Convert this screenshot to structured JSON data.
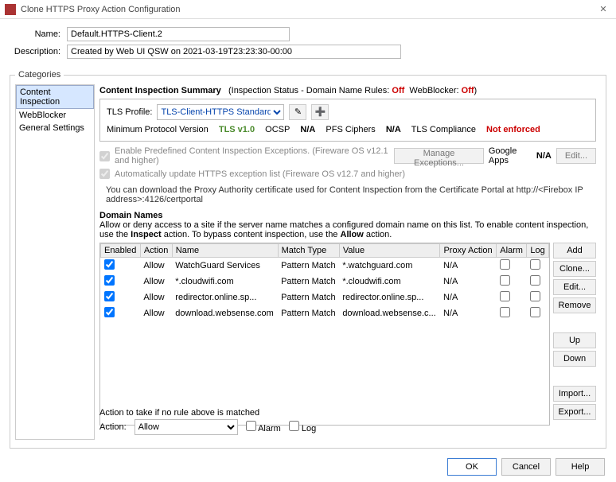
{
  "title": "Clone HTTPS Proxy Action Configuration",
  "name_label": "Name:",
  "name_value": "Default.HTTPS-Client.2",
  "desc_label": "Description:",
  "desc_value": "Created by Web UI QSW on 2021-03-19T23:23:30-00:00",
  "categories_legend": "Categories",
  "sidebar": {
    "items": [
      {
        "label": "Content Inspection",
        "active": true
      },
      {
        "label": "WebBlocker",
        "active": false
      },
      {
        "label": "General Settings",
        "active": false
      }
    ]
  },
  "summary": {
    "title": "Content Inspection Summary",
    "status_label": "(Inspection Status - Domain Name Rules:",
    "dnr": "Off",
    "wb_label": "WebBlocker:",
    "wb": "Off",
    "close": ")"
  },
  "tls": {
    "label": "TLS Profile:",
    "selected": "TLS-Client-HTTPS Standard",
    "min_proto_label": "Minimum Protocol Version",
    "min_proto": "TLS v1.0",
    "ocsp_label": "OCSP",
    "ocsp": "N/A",
    "pfs_label": "PFS Ciphers",
    "pfs": "N/A",
    "compl_label": "TLS Compliance",
    "compl": "Not enforced"
  },
  "cb1_text": "Enable Predefined Content Inspection Exceptions. (Fireware OS v12.1 and higher)",
  "cb1_btn": "Manage Exceptions...",
  "google_label": "Google Apps",
  "google_val": "N/A",
  "edit_btn": "Edit...",
  "cb2_text": "Automatically update HTTPS exception list (Fireware OS v12.7 and higher)",
  "note": "You can download the Proxy Authority certificate used for Content Inspection from the Certificate Portal at http://<Firebox IP address>:4126/certportal",
  "dn_title": "Domain Names",
  "dn_desc1": "Allow or deny access to a site if the server name matches a configured domain name on this list. To enable content inspection, use the ",
  "dn_desc_inspect": "Inspect",
  "dn_desc2": " action. To bypass content inspection, use the ",
  "dn_desc_allow": "Allow",
  "dn_desc3": " action.",
  "columns": {
    "enabled": "Enabled",
    "action": "Action",
    "name": "Name",
    "match": "Match Type",
    "value": "Value",
    "proxy": "Proxy Action",
    "alarm": "Alarm",
    "log": "Log"
  },
  "rows": [
    {
      "action": "Allow",
      "name": "WatchGuard Services",
      "match": "Pattern Match",
      "value": "*.watchguard.com",
      "proxy": "N/A"
    },
    {
      "action": "Allow",
      "name": "*.cloudwifi.com",
      "match": "Pattern Match",
      "value": "*.cloudwifi.com",
      "proxy": "N/A"
    },
    {
      "action": "Allow",
      "name": "redirector.online.sp...",
      "match": "Pattern Match",
      "value": "redirector.online.sp...",
      "proxy": "N/A"
    },
    {
      "action": "Allow",
      "name": "download.websense.com",
      "match": "Pattern Match",
      "value": "download.websense.c...",
      "proxy": "N/A"
    }
  ],
  "btns": {
    "add": "Add",
    "clone": "Clone...",
    "edit": "Edit...",
    "remove": "Remove",
    "up": "Up",
    "down": "Down",
    "import": "Import...",
    "export": "Export..."
  },
  "bottom_lbl": "Action to take if no rule above is matched",
  "bottom_action_lbl": "Action:",
  "bottom_action": "Allow",
  "bottom_alarm": "Alarm",
  "bottom_log": "Log",
  "footer": {
    "ok": "OK",
    "cancel": "Cancel",
    "help": "Help"
  }
}
